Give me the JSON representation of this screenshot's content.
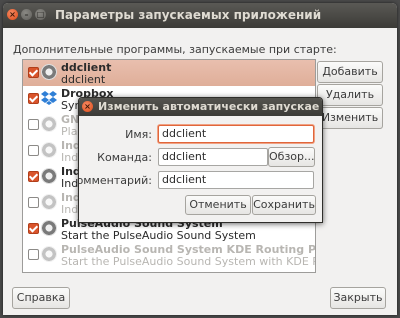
{
  "window": {
    "title": "Параметры запускаемых приложений",
    "close_glyph": "×",
    "minimize_glyph": "–",
    "maximize_glyph": "□"
  },
  "section_label": "Дополнительные программы, запускаемые при старте:",
  "startup_items": [
    {
      "name": "ddclient",
      "description": "ddclient",
      "enabled": true,
      "icon": "gear-icon"
    },
    {
      "name": "Dropbox",
      "description": "Syn",
      "enabled": true,
      "icon": "dropbox-icon"
    },
    {
      "name": "GN",
      "description": "Pla",
      "enabled": false,
      "icon": "gear-icon"
    },
    {
      "name": "Ind",
      "description": "Ind",
      "enabled": false,
      "icon": "gear-icon"
    },
    {
      "name": "Ind",
      "description": "Ind",
      "enabled": true,
      "icon": "gear-icon"
    },
    {
      "name": "Ind",
      "description": "Ind",
      "enabled": false,
      "icon": "gear-icon"
    },
    {
      "name": "PulseAudio Sound System",
      "description": "Start the PulseAudio Sound System",
      "enabled": true,
      "icon": "gear-icon"
    },
    {
      "name": "PulseAudio Sound System KDE Routing Policy",
      "description": "Start the PulseAudio Sound System with KDE Routing Po...",
      "enabled": false,
      "icon": "gear-icon"
    }
  ],
  "side_buttons": {
    "add": "Добавить",
    "remove": "Удалить",
    "edit": "Изменить"
  },
  "bottom_buttons": {
    "help": "Справка",
    "close": "Закрыть"
  },
  "dialog": {
    "title": "Изменить автоматически запускаемую про",
    "close_glyph": "×",
    "name_label": "Имя:",
    "name_value": "ddclient",
    "command_label": "Команда:",
    "command_value": "ddclient",
    "browse_button": "Обзор...",
    "comment_label": "Комментарий:",
    "comment_value": "ddclient",
    "cancel_button": "Отменить",
    "save_button": "Сохранить"
  },
  "colors": {
    "accent": "#df4a16",
    "selection": "#e9bfae",
    "titlebar": "#3c3b37"
  }
}
